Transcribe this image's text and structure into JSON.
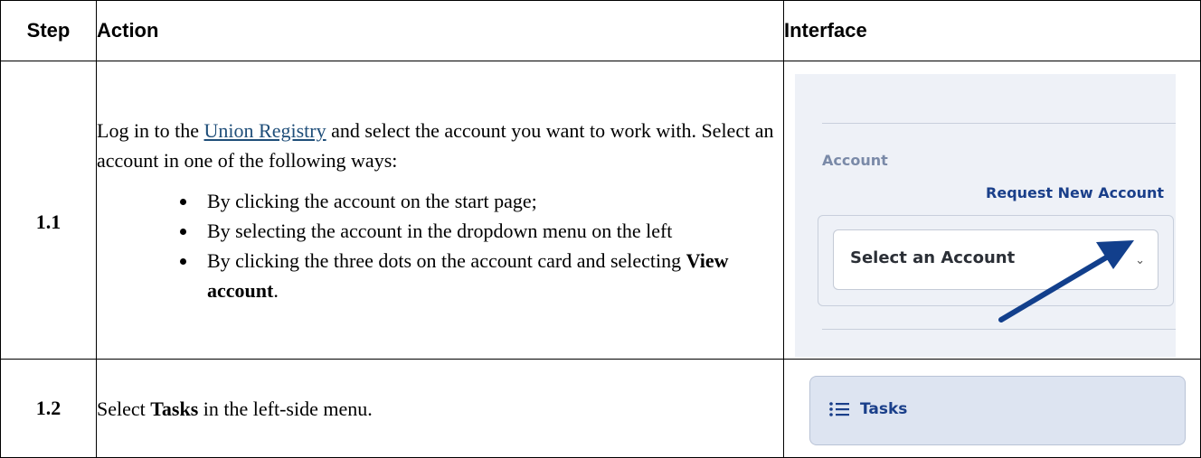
{
  "header": {
    "step": "Step",
    "action": "Action",
    "interface": "Interface"
  },
  "rows": [
    {
      "step": "1.1",
      "action_before_link": "Log in to the ",
      "action_link": "Union Registry",
      "action_after_link": " and select the account you want to work with. Select an account in one of the following ways:",
      "bullets": [
        "By clicking the account on the start page;",
        "By selecting the account in the dropdown menu on the left"
      ],
      "bullet3_before": "By clicking the three dots on the account card and selecting ",
      "bullet3_bold": "View account",
      "bullet3_after": ".",
      "ui": {
        "account_label": "Account",
        "request_link": "Request New Account",
        "select_placeholder": "Select an Account",
        "chevron_icon": "chevron-down-icon",
        "arrow_icon": "arrow-pointer-icon",
        "arrow_color": "#123f8c"
      }
    },
    {
      "step": "1.2",
      "action_before": "Select ",
      "action_bold": "Tasks",
      "action_after": " in the left-side menu.",
      "ui": {
        "tasks_label": "Tasks",
        "tasks_icon": "list-icon",
        "accent": "#1a3f8a"
      }
    }
  ]
}
